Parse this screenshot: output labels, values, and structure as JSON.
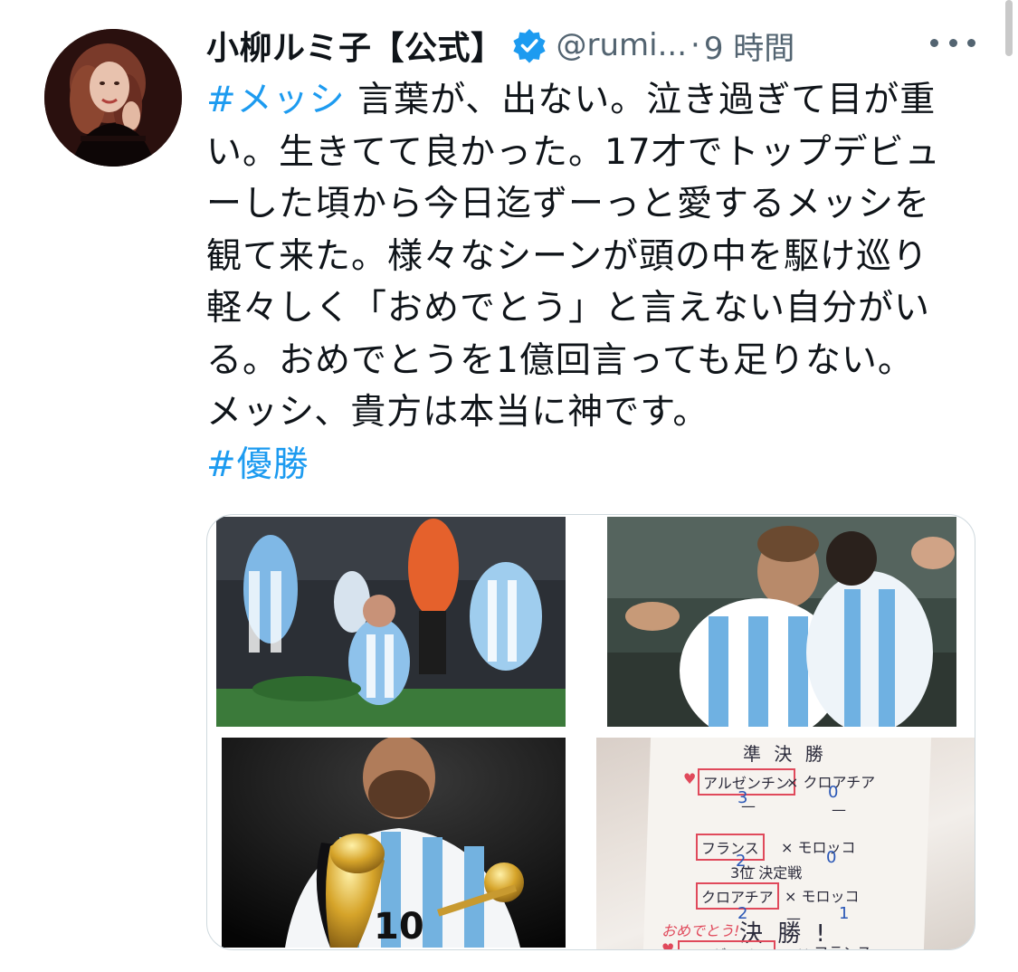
{
  "tweet": {
    "author": {
      "display_name": "小柳ルミ子【公式】",
      "handle": "@rumi...",
      "verified_icon": "verified-badge-icon",
      "avatar": "profile-photo"
    },
    "separator": "·",
    "timestamp": "9 時間",
    "more_icon": "more-options-icon",
    "text_lines": [
      {
        "hashtag": "#メッシ",
        "text": " 言葉が、出ない。泣き過ぎて目が重"
      },
      {
        "text": "い。生きてて良かった。17才でトップデビュ"
      },
      {
        "text": "ーした頃から今日迄ずーっと愛するメッシを"
      },
      {
        "text": "観て来た。様々なシーンが頭の中を駆け巡り"
      },
      {
        "text": "軽々しく「おめでとう」と言えない自分がい"
      },
      {
        "text": "る。おめでとうを1億回言っても足りない。"
      },
      {
        "text": "メッシ、貴方は本当に神です。"
      }
    ],
    "hashtag_2": "#優勝",
    "media": {
      "photo_4_handwriting": {
        "title": "準 決 勝",
        "match1_team_a": "アルゼンチン",
        "match1_x": "× クロアチア",
        "match1_score_a": "3",
        "match1_score_b": "0",
        "match2_team_a": "フランス",
        "match2_x": "× モロッコ",
        "match2_score_a": "2",
        "match2_score_b": "0",
        "third_place": "3位 決定戦",
        "match3_team_a": "クロアチア",
        "match3_x": "× モロッコ",
        "match3_score_a": "2",
        "match3_score_b": "1",
        "dash": "—",
        "congrats": "おめでとう!",
        "final": "決 勝 !",
        "final_team_a": "アルゼンチン",
        "final_team_b": "× フランス",
        "heart": "♥"
      }
    }
  },
  "colors": {
    "link": "#1d9bf0",
    "text": "#0f1419",
    "muted": "#536471",
    "border": "#cfd9de",
    "argentina_blue": "#74b3e3"
  }
}
